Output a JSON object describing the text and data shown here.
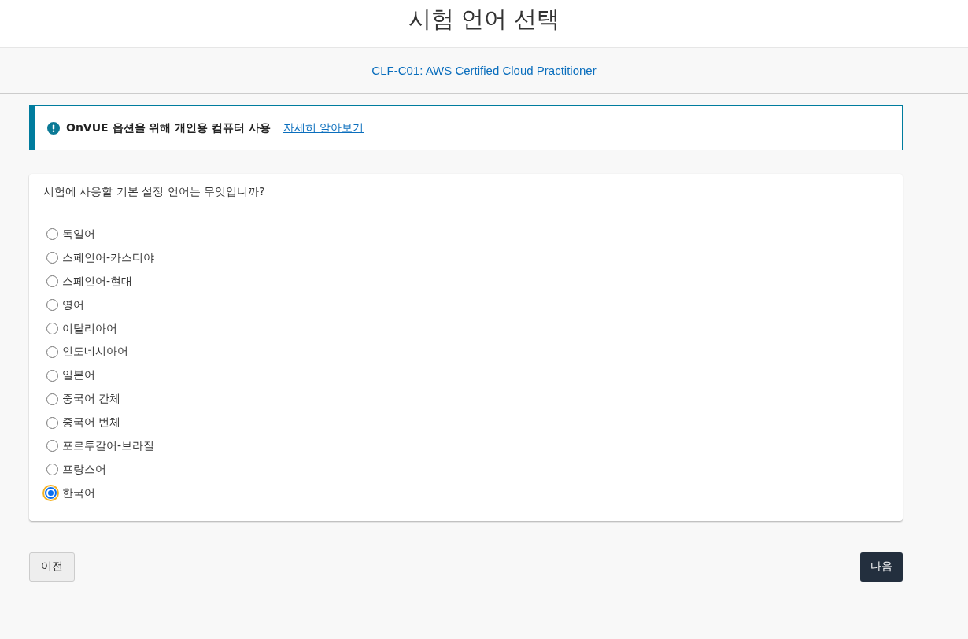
{
  "page_title": "시험 언어 선택",
  "exam": {
    "name": "CLF-C01: AWS Certified Cloud Practitioner"
  },
  "alert": {
    "message": "OnVUE 옵션을 위해 개인용 컴퓨터 사용",
    "link": "자세히 알아보기"
  },
  "question": "시험에 사용할 기본 설정 언어는 무엇입니까?",
  "options": [
    {
      "label": "독일어",
      "selected": false
    },
    {
      "label": "스페인어-카스티야",
      "selected": false
    },
    {
      "label": "스페인어-현대",
      "selected": false
    },
    {
      "label": "영어",
      "selected": false
    },
    {
      "label": "이탈리아어",
      "selected": false
    },
    {
      "label": "인도네시아어",
      "selected": false
    },
    {
      "label": "일본어",
      "selected": false
    },
    {
      "label": "중국어 간체",
      "selected": false
    },
    {
      "label": "중국어 번체",
      "selected": false
    },
    {
      "label": "포르투갈어-브라질",
      "selected": false
    },
    {
      "label": "프랑스어",
      "selected": false
    },
    {
      "label": "한국어",
      "selected": true
    }
  ],
  "buttons": {
    "back": "이전",
    "next": "다음"
  }
}
